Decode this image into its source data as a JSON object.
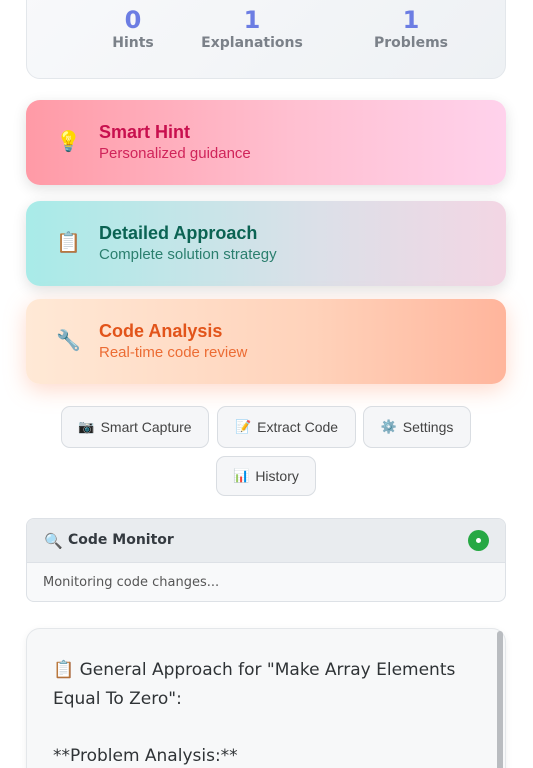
{
  "stats": [
    {
      "value": "0",
      "label": "Hints"
    },
    {
      "value": "1",
      "label": "Explanations"
    },
    {
      "value": "1",
      "label": "Problems"
    }
  ],
  "cards": {
    "hint": {
      "icon": "💡",
      "title": "Smart Hint",
      "subtitle": "Personalized guidance"
    },
    "approach": {
      "icon": "📋",
      "title": "Detailed Approach",
      "subtitle": "Complete solution strategy"
    },
    "analysis": {
      "icon": "🔧",
      "title": "Code Analysis",
      "subtitle": "Real-time code review"
    }
  },
  "toolbar": {
    "capture": {
      "icon": "📷",
      "label": "Smart Capture"
    },
    "extract": {
      "icon": "📝",
      "label": "Extract Code"
    },
    "settings": {
      "icon": "⚙️",
      "label": "Settings"
    },
    "history": {
      "icon": "📊",
      "label": "History"
    }
  },
  "monitor": {
    "icon": "🔍",
    "title": "Code Monitor",
    "status": "Monitoring code changes...",
    "status_color": "#27a844"
  },
  "output": {
    "line1": "📋 General Approach for \"Make Array Elements",
    "line2": "Equal To Zero\":",
    "line3": "**Problem Analysis:**"
  },
  "colors": {
    "stat_number": "#6c7de3",
    "hint_title": "#c8104e",
    "approach_title": "#0b6353",
    "analysis_title": "#e2541a"
  }
}
